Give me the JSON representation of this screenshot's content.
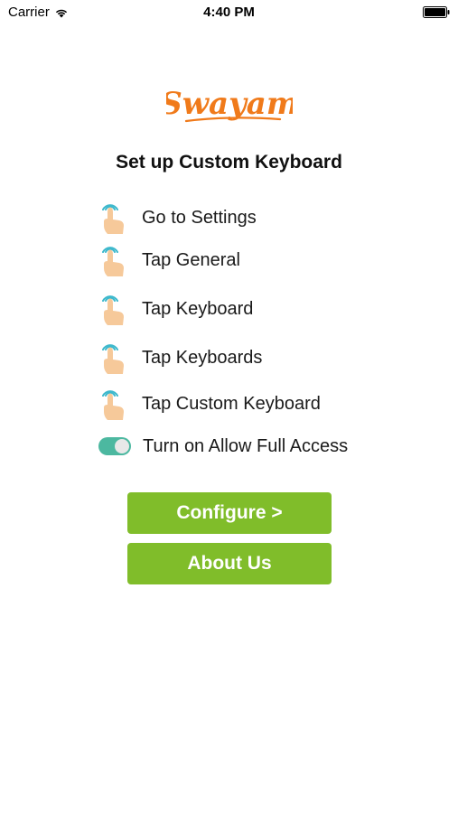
{
  "status_bar": {
    "carrier": "Carrier",
    "time": "4:40 PM",
    "wifi_icon": "wifi-icon",
    "battery_icon": "battery-icon"
  },
  "logo": {
    "text": "Swayam",
    "color": "#f07a1a"
  },
  "title": "Set up Custom Keyboard",
  "steps": [
    {
      "label": "Go to Settings",
      "icon": "tap-hand-icon"
    },
    {
      "label": "Tap General",
      "icon": "tap-hand-icon"
    },
    {
      "label": "Tap Keyboard",
      "icon": "tap-hand-icon"
    },
    {
      "label": "Tap Keyboards",
      "icon": "tap-hand-icon"
    },
    {
      "label": "Tap Custom Keyboard",
      "icon": "tap-hand-icon"
    },
    {
      "label": "Turn on Allow Full Access",
      "icon": "toggle-on-icon"
    }
  ],
  "buttons": {
    "configure": "Configure >",
    "about_us": "About Us"
  },
  "colors": {
    "button_bg": "#80bd2a",
    "toggle_on": "#4cb8a0",
    "tap_ring": "#3cb8cc",
    "hand_skin": "#f6c99a"
  }
}
